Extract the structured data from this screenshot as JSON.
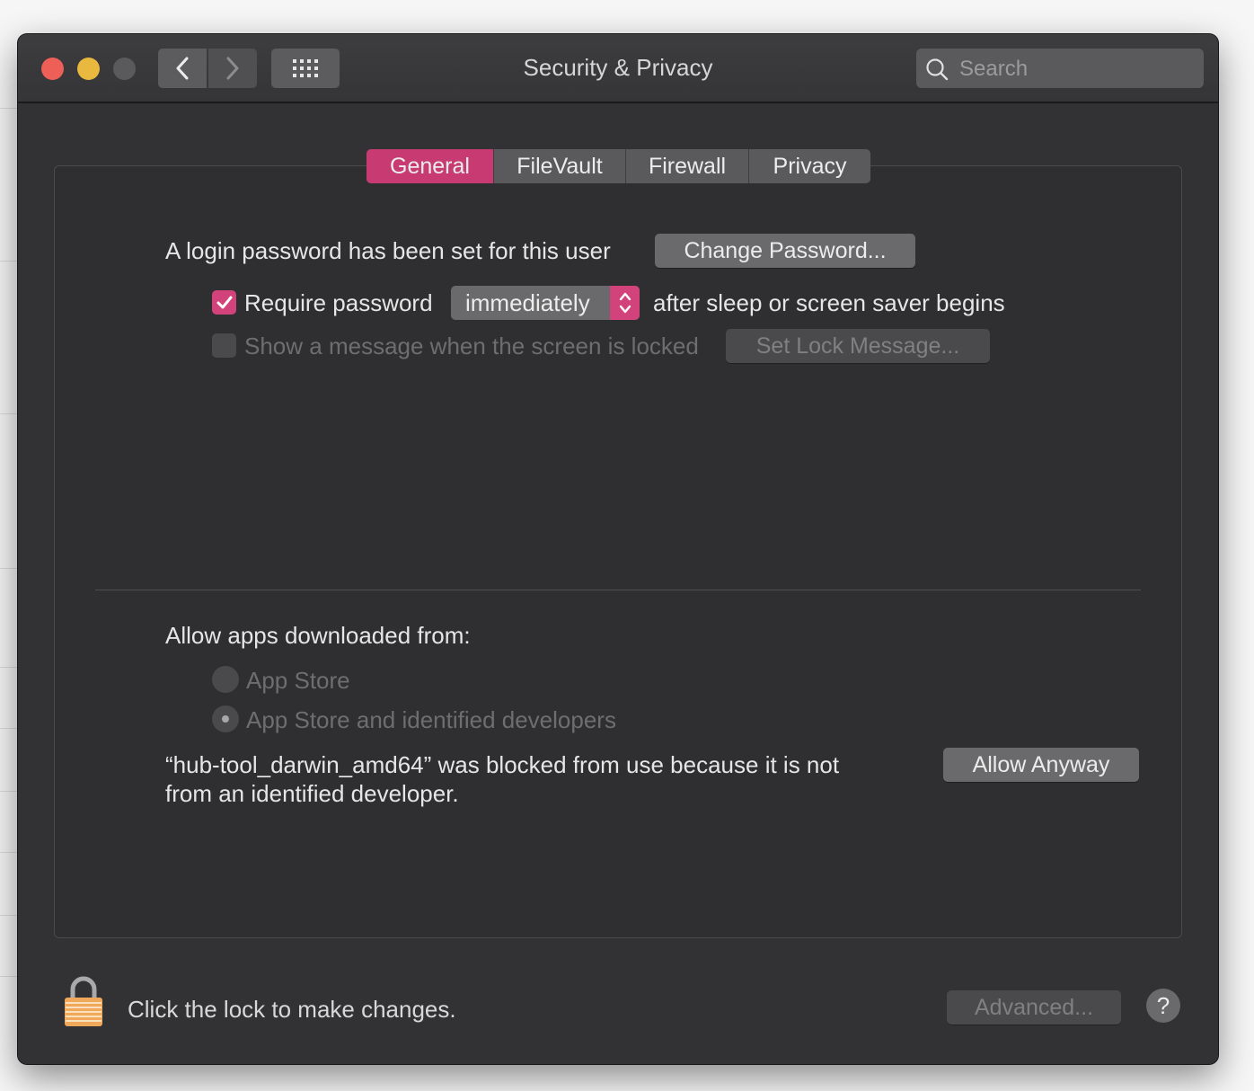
{
  "window": {
    "title": "Security & Privacy"
  },
  "search": {
    "placeholder": "Search"
  },
  "tabs": [
    {
      "label": "General",
      "active": true
    },
    {
      "label": "FileVault",
      "active": false
    },
    {
      "label": "Firewall",
      "active": false
    },
    {
      "label": "Privacy",
      "active": false
    }
  ],
  "general": {
    "login_text": "A login password has been set for this user",
    "change_password_label": "Change Password...",
    "require_password_label": "Require password",
    "require_password_checked": true,
    "require_password_popup_value": "immediately",
    "after_sleep_text": "after sleep or screen saver begins",
    "show_message_label": "Show a message when the screen is locked",
    "show_message_checked": false,
    "set_lock_message_label": "Set Lock Message...",
    "allow_apps_heading": "Allow apps downloaded from:",
    "radio_app_store_label": "App Store",
    "radio_identified_label": "App Store and identified developers",
    "blocked_line1": "“hub-tool_darwin_amd64” was blocked from use because it is not",
    "blocked_line2": "from an identified developer.",
    "allow_anyway_label": "Allow Anyway"
  },
  "footer": {
    "lock_text": "Click the lock to make changes.",
    "advanced_label": "Advanced...",
    "help_label": "?"
  },
  "icons": [
    "close-button",
    "minimize-button",
    "zoom-button",
    "chevron-left-icon",
    "chevron-right-icon",
    "grid-icon",
    "search-icon",
    "checkmark-icon",
    "updown-arrows-icon",
    "padlock-icon"
  ],
  "colors": {
    "accent": "#d2437c",
    "window_bg": "#323234",
    "close": "#ed5f57",
    "minimize": "#e9b93f",
    "lock": "#f0a85a"
  }
}
